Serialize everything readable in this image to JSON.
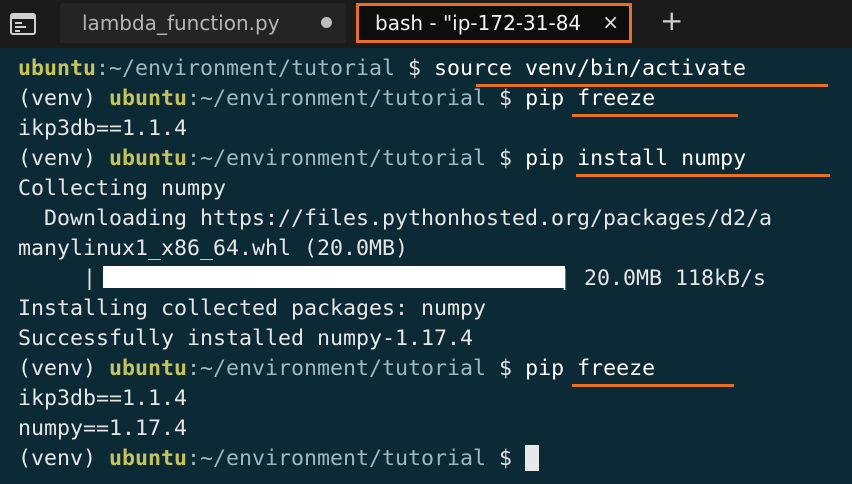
{
  "tabs": {
    "editor_label": "lambda_function.py",
    "terminal_label": "bash - \"ip-172-31-84",
    "close_glyph": "×",
    "add_glyph": "+"
  },
  "prompt": {
    "user": "ubuntu",
    "path": ":~/environment/tutorial",
    "dollar": " $ ",
    "venv": "(venv) "
  },
  "commands": {
    "cmd1": "source venv/bin/activate",
    "cmd2": "pip freeze",
    "cmd3": "pip install numpy",
    "cmd4": "pip freeze"
  },
  "output": {
    "freeze1": "ikp3db==1.1.4",
    "collecting": "Collecting numpy",
    "downloading": "  Downloading https://files.pythonhosted.org/packages/d2/a",
    "wheel": "manylinux1_x86_64.whl (20.0MB)",
    "progress_left": "     |",
    "progress_right": "| 20.0MB 118kB/s",
    "progress_fraction": 1.0,
    "installing": "Installing collected packages: numpy",
    "installed": "Successfully installed numpy-1.17.4",
    "freeze2_line1": "ikp3db==1.1.4",
    "freeze2_line2": "numpy==1.17.4"
  },
  "colors": {
    "accent": "#e8701f",
    "terminal_bg": "#0b2a36",
    "user": "#c6c35a",
    "path": "#9fb6c4"
  }
}
